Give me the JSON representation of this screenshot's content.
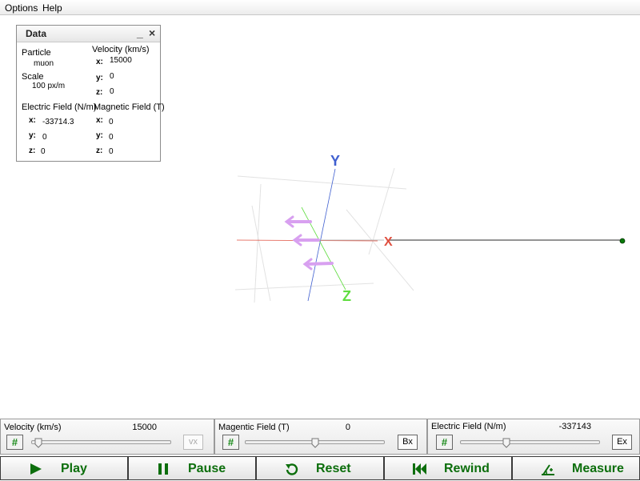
{
  "menu": {
    "options": "Options",
    "help": "Help"
  },
  "data_panel": {
    "title": "Data",
    "minimize": "_",
    "close": "×",
    "particle_label": "Particle",
    "particle_value": "muon",
    "scale_label": "Scale",
    "scale_value": "100 px/m",
    "velocity_label": "Velocity (km/s)",
    "velocity": {
      "x": "15000",
      "y": "0",
      "z": "0"
    },
    "electric_label": "Electric Field (N/m)",
    "electric": {
      "x": "-33714.3",
      "y": "0",
      "z": "0"
    },
    "magnetic_label": "Magnetic Field (T)",
    "magnetic": {
      "x": "0",
      "y": "0",
      "z": "0"
    },
    "axis_x": "x:",
    "axis_y": "y:",
    "axis_z": "z:"
  },
  "scene": {
    "axis_x_label": "X",
    "axis_y_label": "Y",
    "axis_z_label": "Z",
    "colors": {
      "x": "#e05040",
      "y": "#4060d0",
      "z": "#60dd40",
      "arrow": "#d8a0f0"
    }
  },
  "controls": {
    "velocity": {
      "label": "Velocity (km/s)",
      "value": "15000",
      "axis_button": "vx",
      "thumb_fraction": 0.05
    },
    "magnetic": {
      "label": "Magentic Field (T)",
      "value": "0",
      "axis_button": "Bx",
      "thumb_fraction": 0.5
    },
    "electric": {
      "label": "Electric Field (N/m)",
      "value": "-337143",
      "axis_button": "Ex",
      "thumb_fraction": 0.33
    },
    "hash": "#"
  },
  "actions": {
    "play": "Play",
    "pause": "Pause",
    "reset": "Reset",
    "rewind": "Rewind",
    "measure": "Measure"
  }
}
